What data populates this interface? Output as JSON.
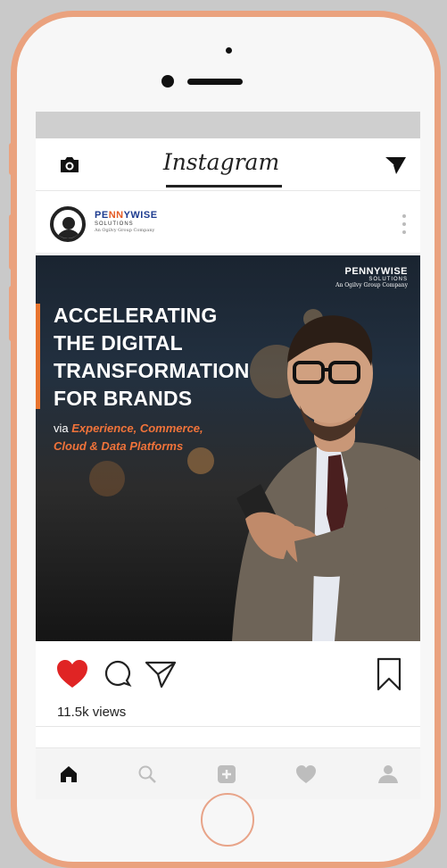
{
  "app": {
    "title": "Instagram"
  },
  "post": {
    "account": {
      "name_part1": "PE",
      "name_accent": "NN",
      "name_part2": "YWISE",
      "sub": "SOLUTIONS",
      "tag": "An Ogilvy Group Company"
    },
    "image": {
      "credit_name": "PENNYWISE",
      "credit_sub": "SOLUTIONS",
      "credit_tag": "An Ogilvy Group Company",
      "headline": [
        "ACCELERATING",
        "THE DIGITAL",
        "TRANSFORMATION",
        "FOR BRANDS"
      ],
      "subline_prefix": "via ",
      "subline_highlight_1": "Experience, Commerce,",
      "subline_highlight_2": "Cloud & Data Platforms"
    },
    "liked": true,
    "views": "11.5k views"
  },
  "icons": {
    "camera": "camera-icon",
    "direct": "paper-plane-icon",
    "more": "vertical-dots-icon",
    "like": "heart-icon",
    "comment": "comment-bubble-icon",
    "share": "paper-plane-outline-icon",
    "save": "bookmark-icon"
  },
  "nav": [
    "home-icon",
    "search-icon",
    "add-icon",
    "activity-heart-icon",
    "profile-icon"
  ],
  "colors": {
    "phone_frame": "#eaa27e",
    "like_red": "#e02424",
    "brand_blue": "#1d3b8f",
    "brand_orange": "#e45a24",
    "highlight_orange": "#f0733a"
  }
}
